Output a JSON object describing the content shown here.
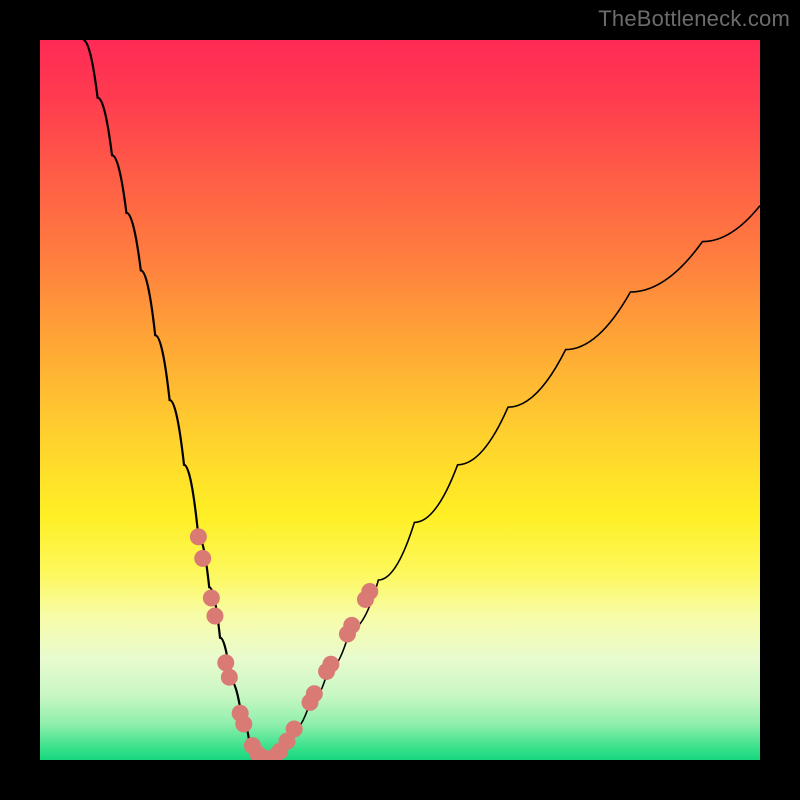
{
  "watermark": "TheBottleneck.com",
  "colors": {
    "black": "#000000",
    "curve": "#000000",
    "dot_fill": "#d97a74",
    "dot_stroke": "#b55e58",
    "gradient_stops": [
      {
        "offset": 0,
        "color": "#ff2a55"
      },
      {
        "offset": 0.08,
        "color": "#ff3b4f"
      },
      {
        "offset": 0.18,
        "color": "#ff5a47"
      },
      {
        "offset": 0.3,
        "color": "#ff7d3f"
      },
      {
        "offset": 0.42,
        "color": "#ffa636"
      },
      {
        "offset": 0.55,
        "color": "#ffd12e"
      },
      {
        "offset": 0.66,
        "color": "#ffef25"
      },
      {
        "offset": 0.74,
        "color": "#fdf85c"
      },
      {
        "offset": 0.8,
        "color": "#f8fca8"
      },
      {
        "offset": 0.86,
        "color": "#e8fbcf"
      },
      {
        "offset": 0.91,
        "color": "#c8f7c3"
      },
      {
        "offset": 0.95,
        "color": "#8fefac"
      },
      {
        "offset": 0.985,
        "color": "#34e08a"
      },
      {
        "offset": 1.0,
        "color": "#17d67d"
      }
    ]
  },
  "chart_data": {
    "type": "line",
    "title": "",
    "xlabel": "",
    "ylabel": "",
    "xlim": [
      0,
      100
    ],
    "ylim": [
      0,
      100
    ],
    "grid": false,
    "legend": false,
    "series": [
      {
        "name": "left-branch",
        "x": [
          6,
          8,
          10,
          12,
          14,
          16,
          18,
          20,
          22,
          23.5,
          25,
          26.5,
          28,
          29,
          30,
          30.8,
          31.5
        ],
        "y": [
          100,
          92,
          84,
          76,
          68,
          59,
          50,
          41,
          31,
          24,
          17,
          11,
          6,
          3,
          1,
          0.3,
          0
        ]
      },
      {
        "name": "right-branch",
        "x": [
          31.5,
          33,
          35,
          37.5,
          40,
          43,
          47,
          52,
          58,
          65,
          73,
          82,
          92,
          100
        ],
        "y": [
          0,
          1.5,
          4,
          8,
          12.5,
          18,
          25,
          33,
          41,
          49,
          57,
          65,
          72,
          77
        ]
      },
      {
        "name": "floor",
        "x": [
          28,
          35
        ],
        "y": [
          0,
          0
        ]
      }
    ],
    "datapoints_highlight": [
      {
        "x": 22.0,
        "y": 31.0
      },
      {
        "x": 22.6,
        "y": 28.0
      },
      {
        "x": 23.8,
        "y": 22.5
      },
      {
        "x": 24.3,
        "y": 20.0
      },
      {
        "x": 25.8,
        "y": 13.5
      },
      {
        "x": 26.3,
        "y": 11.5
      },
      {
        "x": 27.8,
        "y": 6.5
      },
      {
        "x": 28.3,
        "y": 5.0
      },
      {
        "x": 29.5,
        "y": 2.0
      },
      {
        "x": 30.3,
        "y": 0.8
      },
      {
        "x": 31.0,
        "y": 0.3
      },
      {
        "x": 31.8,
        "y": 0.1
      },
      {
        "x": 32.5,
        "y": 0.4
      },
      {
        "x": 33.3,
        "y": 1.2
      },
      {
        "x": 34.3,
        "y": 2.6
      },
      {
        "x": 35.3,
        "y": 4.3
      },
      {
        "x": 37.5,
        "y": 8.0
      },
      {
        "x": 38.1,
        "y": 9.2
      },
      {
        "x": 39.8,
        "y": 12.3
      },
      {
        "x": 40.4,
        "y": 13.3
      },
      {
        "x": 42.7,
        "y": 17.5
      },
      {
        "x": 43.3,
        "y": 18.7
      },
      {
        "x": 45.2,
        "y": 22.3
      },
      {
        "x": 45.8,
        "y": 23.4
      }
    ]
  }
}
